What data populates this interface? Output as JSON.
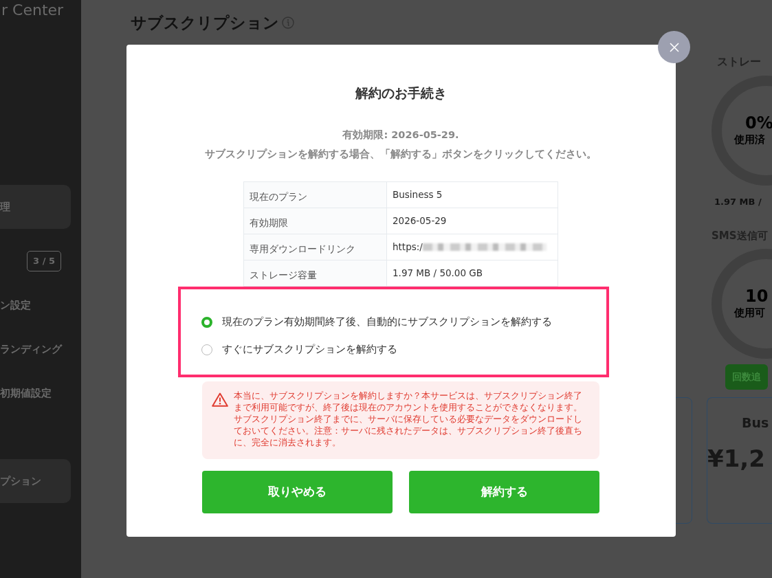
{
  "sidebar": {
    "brand": "r Center",
    "items": [
      {
        "label": "理",
        "selected": true
      },
      {
        "badge": "3 / 5",
        "selected": false
      },
      {
        "label": "ン設定",
        "selected": false
      },
      {
        "label": "ランディング",
        "selected": false
      },
      {
        "label": "初期値設定",
        "selected": false
      },
      {
        "label": "プション",
        "selected": true
      }
    ]
  },
  "page": {
    "title": "サブスクリプション",
    "storage": {
      "title": "ストレー",
      "value": "0%",
      "caption": "使用済",
      "usage": "1.97 MB /"
    },
    "sms": {
      "title": "SMS送信可",
      "value": "10",
      "caption": "使用可",
      "button": "回数追"
    },
    "plan_card": {
      "name": "Bus",
      "price": "¥1,2"
    }
  },
  "modal": {
    "title": "解約のお手続き",
    "expiry_note": "有効期限: 2026-05-29.",
    "instruction": "サブスクリプションを解約する場合、「解約する」ボタンをクリックしてください。",
    "table": [
      {
        "label": "現在のプラン",
        "value": "Business 5",
        "redacted": false
      },
      {
        "label": "有効期限",
        "value": "2026-05-29",
        "redacted": false
      },
      {
        "label": "専用ダウンロードリンク",
        "value": "https:/",
        "redacted": true
      },
      {
        "label": "ストレージ容量",
        "value": "1.97 MB / 50.00 GB",
        "redacted": false
      }
    ],
    "options": [
      {
        "label": "現在のプラン有効期間終了後、自動的にサブスクリプションを解約する",
        "selected": true
      },
      {
        "label": "すぐにサブスクリプションを解約する",
        "selected": false
      }
    ],
    "warning": "本当に、サブスクリプションを解約しますか？本サービスは、サブスクリプション終了まで利用可能ですが、終了後は現在のアカウントを使用することができなくなります。サブスクリプション終了までに、サーバに保存している必要なデータをダウンロードしておいてください。注意：サーバに残されたデータは、サブスクリプション終了後直ちに、完全に消去されます。",
    "buttons": [
      {
        "label": "取りやめる"
      },
      {
        "label": "解約する"
      }
    ]
  }
}
